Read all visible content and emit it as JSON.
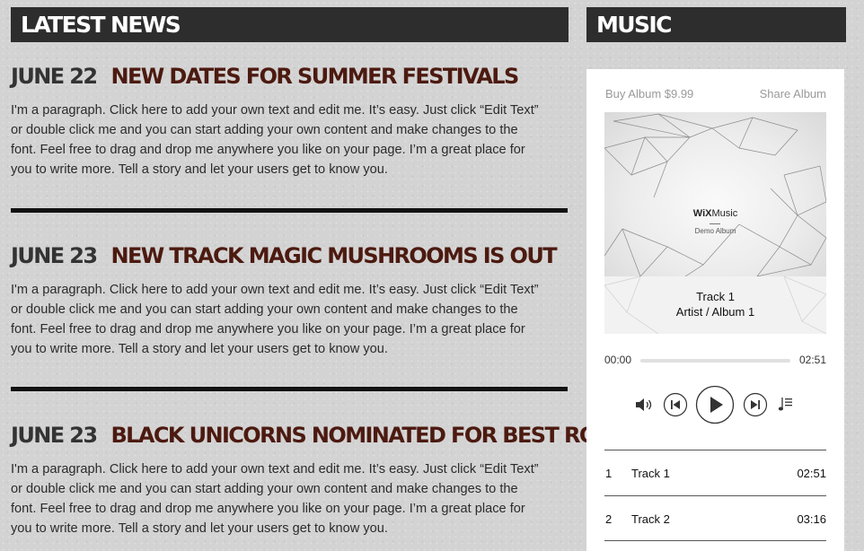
{
  "sections": {
    "news_heading": "LATEST NEWS",
    "music_heading": "MUSIC"
  },
  "news": [
    {
      "date": "JUNE 22",
      "title": "NEW DATES FOR SUMMER FESTIVALS",
      "body": "I'm a paragraph. Click here to add your own text and edit me. It’s easy. Just click “Edit Text” or double click me and you can start adding your own content and make changes to the font. Feel free to drag and drop me anywhere you like on your page. I’m a great place for you to write more. Tell a story and let your users get to know you."
    },
    {
      "date": "JUNE 23",
      "title": "NEW TRACK MAGIC MUSHROOMS IS OUT",
      "body": "I'm a paragraph. Click here to add your own text and edit me. It’s easy. Just click “Edit Text” or double click me and you can start adding your own content and make changes to the font. Feel free to drag and drop me anywhere you like on your page. I’m a great place for you to write more. Tell a story and let your users get to know you."
    },
    {
      "date": "JUNE 23",
      "title": "BLACK UNICORNS NOMINATED FOR BEST ROCK ACT",
      "body": "I'm a paragraph. Click here to add your own text and edit me. It’s easy. Just click “Edit Text” or double click me and you can start adding your own content and make changes to the font. Feel free to drag and drop me anywhere you like on your page. I’m a great place for you to write more. Tell a story and let your users get to know you."
    }
  ],
  "player": {
    "buy_label": "Buy Album $9.99",
    "share_label": "Share Album",
    "cover": {
      "logo_bold": "WiX",
      "logo_light": "Music",
      "subtitle": "Demo Album"
    },
    "now_playing": {
      "track": "Track 1",
      "artist_album": "Artist / Album 1"
    },
    "current_time": "00:00",
    "total_time": "02:51",
    "progress": 0,
    "controls": [
      "volume-icon",
      "previous-icon",
      "play-icon",
      "next-icon",
      "playlist-icon"
    ],
    "tracks": [
      {
        "number": "1",
        "name": "Track 1",
        "duration": "02:51"
      },
      {
        "number": "2",
        "name": "Track 2",
        "duration": "03:16"
      }
    ]
  },
  "colors": {
    "bar_bg": "#2d2d2d",
    "headline": "#4c1a10",
    "date": "#333333",
    "divider": "#111111",
    "page_bg": "#d3d3d3"
  }
}
